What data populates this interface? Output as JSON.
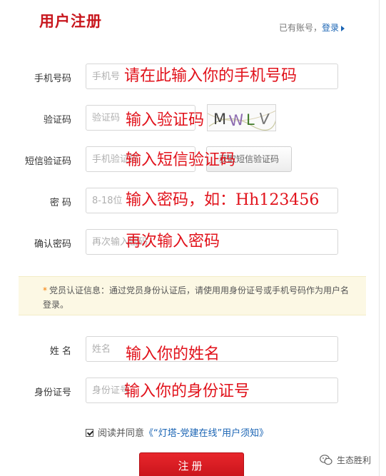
{
  "header": {
    "title": "用户注册",
    "has_account_text": "已有账号，",
    "login_link": "登录"
  },
  "form": {
    "phone": {
      "label": "手机号码",
      "placeholder": "手机号",
      "overlay": "请在此输入你的手机号码"
    },
    "captcha": {
      "label": "验证码",
      "placeholder": "验证码",
      "overlay": "输入验证码",
      "image_text": "MWLV"
    },
    "sms_code": {
      "label": "短信验证码",
      "placeholder": "手机验证码",
      "button": "获取短信验证码",
      "overlay": "输入短信验证码"
    },
    "password": {
      "label": "密  码",
      "placeholder": "8-18位",
      "overlay": "输入密码，如：Hh123456"
    },
    "confirm_password": {
      "label": "确认密码",
      "placeholder": "再次输入密码",
      "overlay": "再次输入密码"
    },
    "notice": {
      "star": "*",
      "text": "党员认证信息：通过党员身份认证后，请使用用身份证号或手机号码作为用户名登录。"
    },
    "name": {
      "label": "姓  名",
      "placeholder": "姓名",
      "overlay": "输入你的姓名"
    },
    "id_number": {
      "label": "身份证号",
      "placeholder": "身份证号",
      "overlay": "输入你的身份证号"
    },
    "agreement": {
      "checked": true,
      "prefix": "阅读并同意",
      "link": "《“灯塔-党建在线”用户须知》"
    },
    "submit_label": "注册"
  },
  "watermark": {
    "icon": "wechat-icon",
    "text": "生态胜利"
  },
  "colors": {
    "brand_red": "#c8161d",
    "overlay_red": "#e1121b",
    "link_blue": "#1a64b4",
    "notice_bg": "#fcf8e4"
  }
}
